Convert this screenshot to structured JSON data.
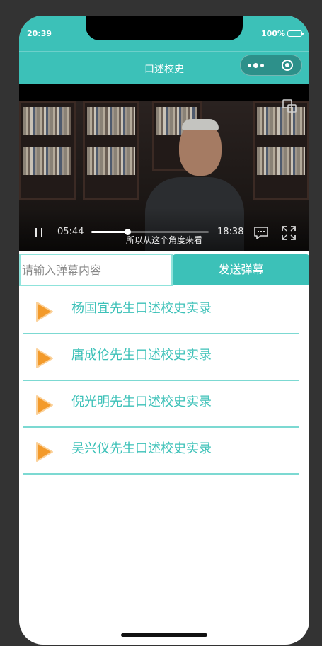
{
  "status_bar": {
    "time": "20:39",
    "battery": "100%"
  },
  "nav": {
    "title": "口述校史"
  },
  "video": {
    "current_time": "05:44",
    "total_time": "18:38",
    "progress": 0.31,
    "subtitle": "所以从这个角度来看"
  },
  "danmu": {
    "input_placeholder": "请输入弹幕内容",
    "send_label": "发送弹幕"
  },
  "list": {
    "items": [
      {
        "label": "杨国宜先生口述校史实录",
        "icon": "play-icon"
      },
      {
        "label": "唐成伦先生口述校史实录",
        "icon": "play-icon"
      },
      {
        "label": "倪光明先生口述校史实录",
        "icon": "play-icon"
      },
      {
        "label": "吴兴仪先生口述校史实录",
        "icon": "play-icon"
      }
    ]
  },
  "colors": {
    "accent": "#3cc1b8",
    "divider": "#7cd9d2",
    "play_icon": "#f39a2a"
  }
}
